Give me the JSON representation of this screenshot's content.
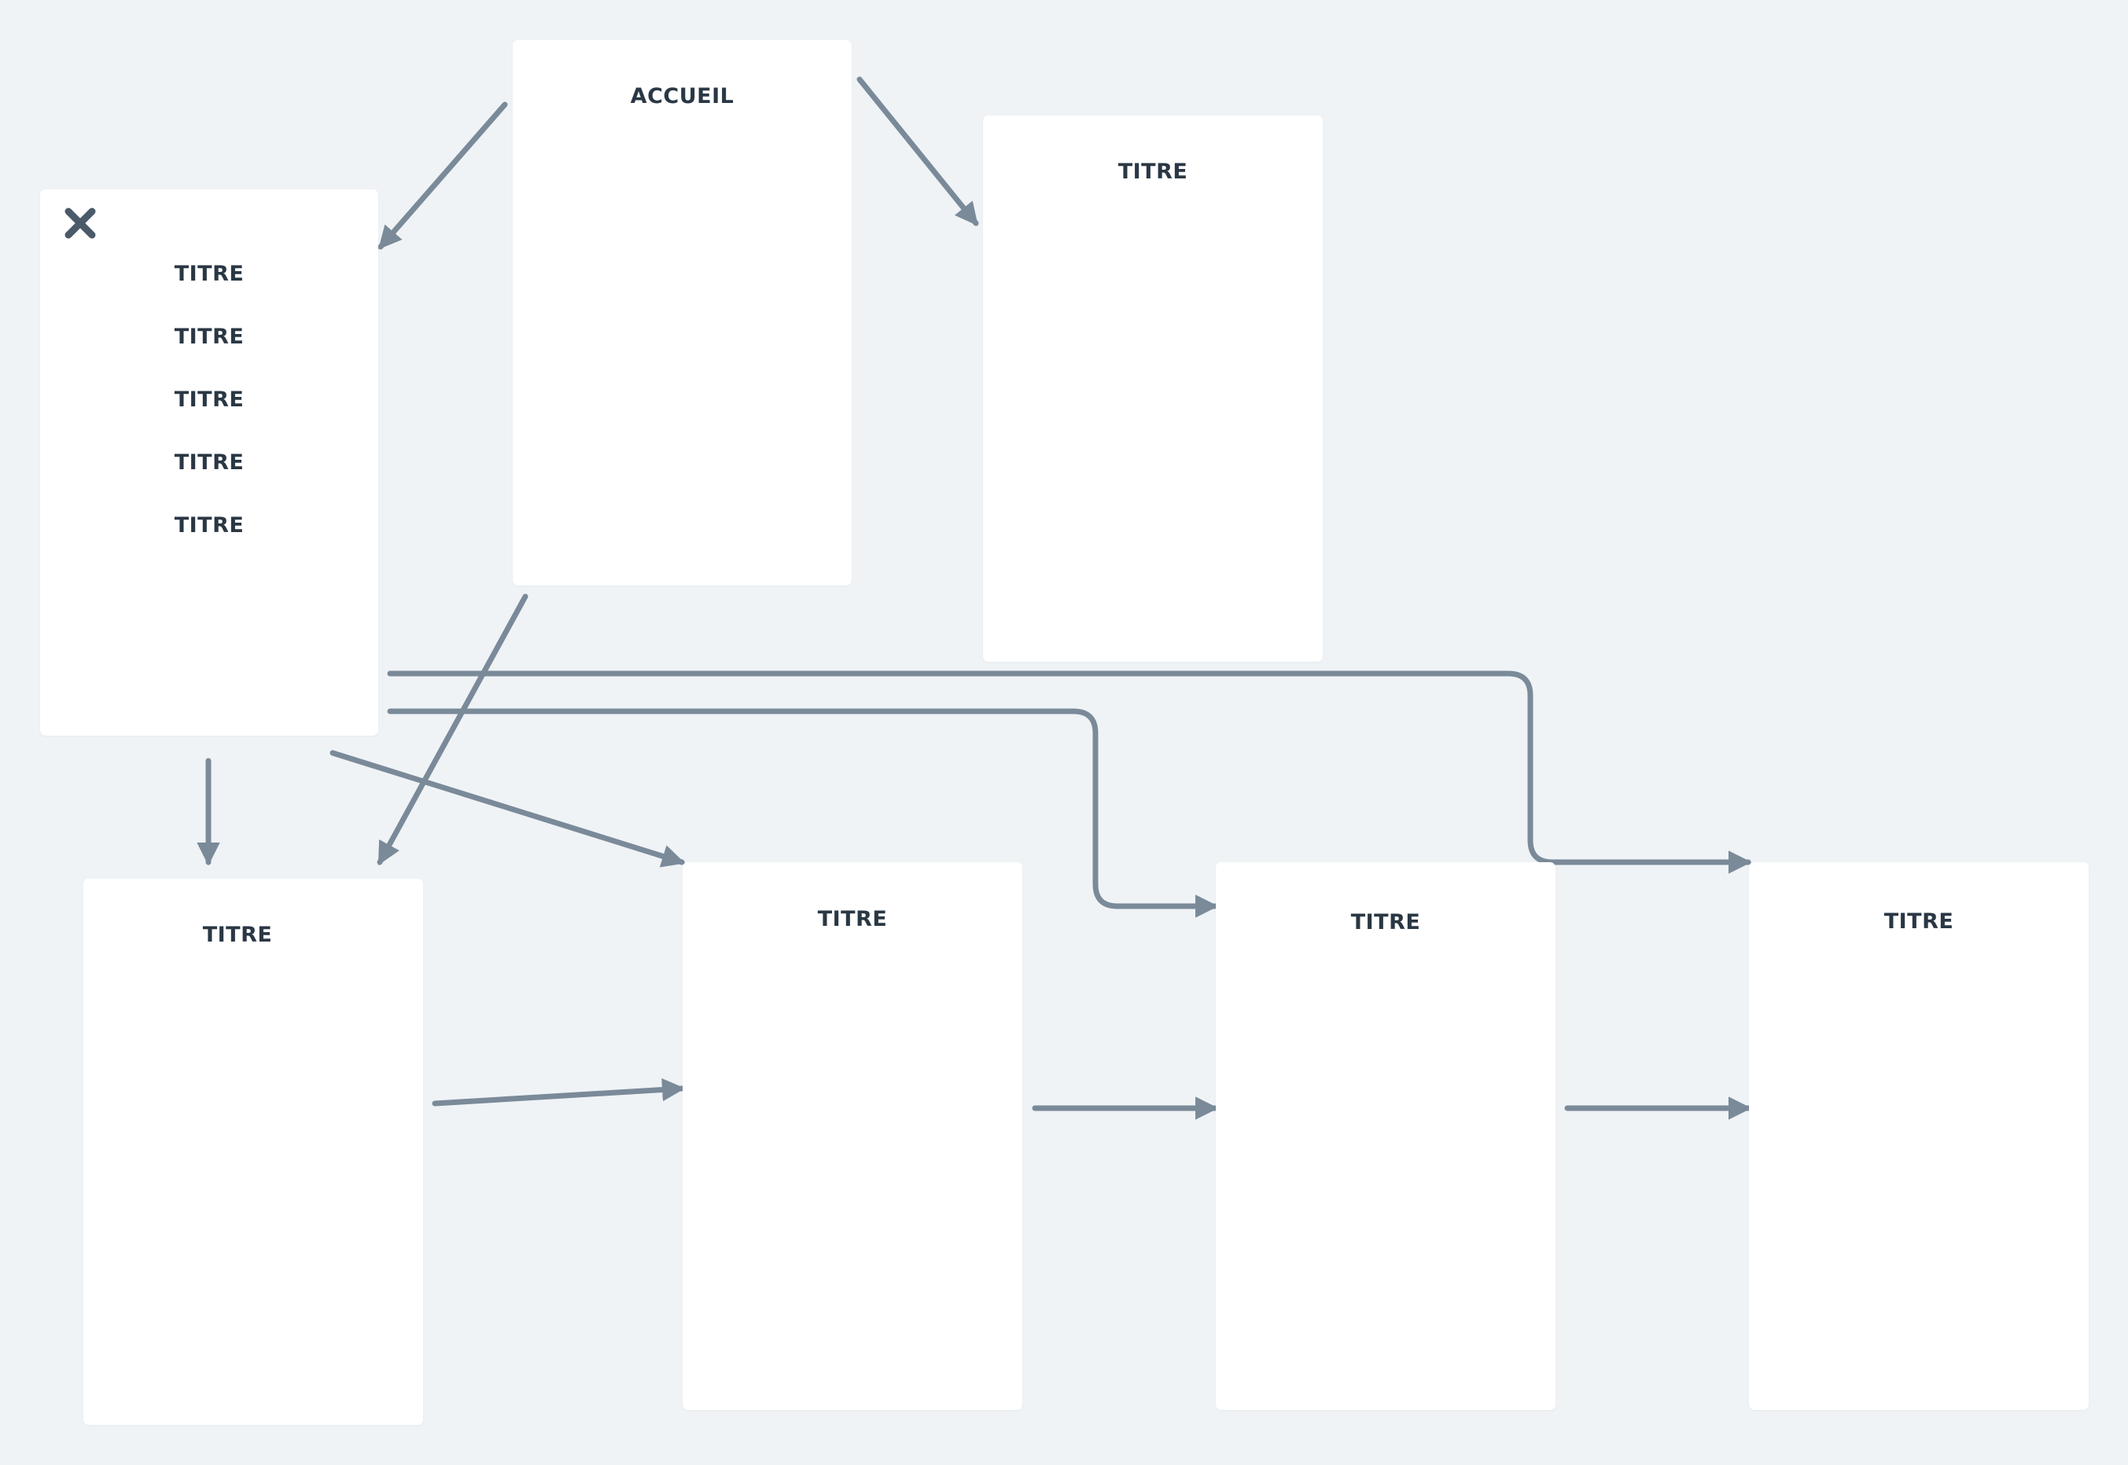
{
  "screens": {
    "home": {
      "title": "ACCUEIL"
    },
    "menu": {
      "items": [
        "TITRE",
        "TITRE",
        "TITRE",
        "TITRE",
        "TITRE"
      ]
    },
    "top_right": {
      "title": "TITRE"
    },
    "bottom_1": {
      "title": "TITRE"
    },
    "bottom_2": {
      "title": "TITRE"
    },
    "bottom_3": {
      "title": "TITRE"
    },
    "bottom_4": {
      "title": "TITRE"
    }
  },
  "icons": {
    "menu_close": "close-icon"
  },
  "colors": {
    "background": "#eff3f6",
    "card": "#ffffff",
    "text": "#2a3744",
    "connector": "#7a8a99",
    "close_icon": "#4a5a69"
  }
}
